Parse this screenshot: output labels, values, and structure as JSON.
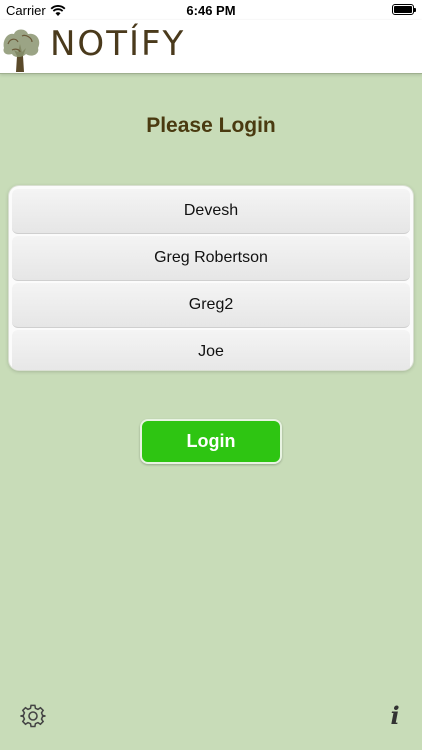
{
  "status_bar": {
    "carrier": "Carrier",
    "time": "6:46 PM",
    "battery_level": 1.0
  },
  "header": {
    "logo_text": "NOTÍFY",
    "logo_icon": "tree-icon"
  },
  "main": {
    "title": "Please Login",
    "users": [
      {
        "label": "Devesh"
      },
      {
        "label": "Greg Robertson"
      },
      {
        "label": "Greg2"
      },
      {
        "label": "Joe"
      }
    ],
    "login_label": "Login"
  },
  "footer": {
    "settings_icon": "gear-icon",
    "info_label": "i"
  },
  "colors": {
    "background": "#c8dcb8",
    "accent_green": "#2ec512",
    "title_brown": "#4a3a10"
  }
}
